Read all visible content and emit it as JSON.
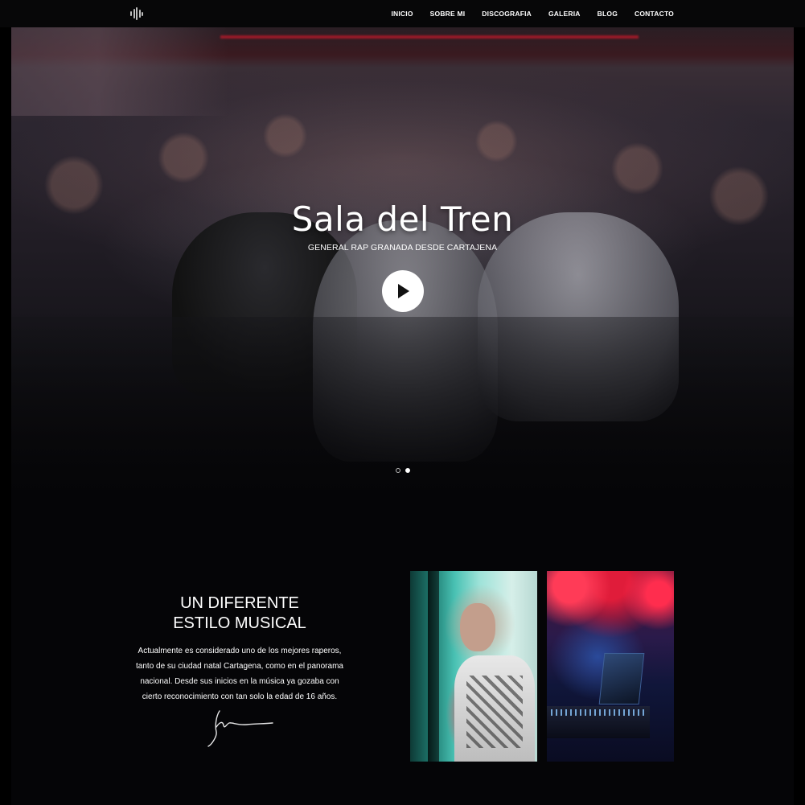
{
  "nav": {
    "logo_icon": "audio-bars-icon",
    "items": [
      {
        "label": "INICIO"
      },
      {
        "label": "SOBRE MI"
      },
      {
        "label": "DISCOGRAFIA"
      },
      {
        "label": "GALERIA"
      },
      {
        "label": "BLOG"
      },
      {
        "label": "CONTACTO"
      }
    ]
  },
  "hero": {
    "title": "Sala del Tren",
    "subtitle": "GENERAL RAP GRANADA DESDE CARTAJENA",
    "play_icon": "play-icon",
    "slides": {
      "count": 2,
      "active": 2
    }
  },
  "about": {
    "heading_line1": "UN DIFERENTE",
    "heading_line2": "ESTILO MUSICAL",
    "body": "Actualmente es considerado uno de los mejores raperos, tanto de su ciudad natal Cartagena, como en el panorama nacional. Desde sus inicios en la música ya gozaba con cierto reconocimiento con tan solo la edad de 16 años."
  },
  "colors": {
    "background": "#050507",
    "text": "#ffffff",
    "accent_red": "#b41a2a",
    "accent_teal": "#49c1b3"
  }
}
